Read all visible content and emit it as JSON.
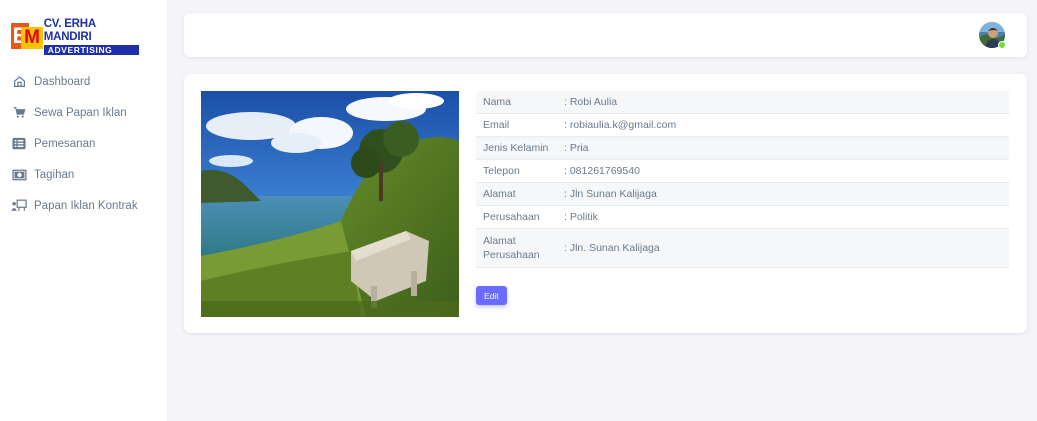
{
  "brand": {
    "logo_line1": "CV. ERHA MANDIRI",
    "logo_line2": "ADVERTISING",
    "colors": {
      "blue": "#1f2fa8",
      "orange": "#e8571a",
      "yellow": "#f5c400"
    }
  },
  "sidebar": {
    "items": [
      {
        "label": "Dashboard",
        "icon": "home-icon"
      },
      {
        "label": "Sewa Papan Iklan",
        "icon": "cart-icon"
      },
      {
        "label": "Pemesanan",
        "icon": "list-icon"
      },
      {
        "label": "Tagihan",
        "icon": "money-icon"
      },
      {
        "label": "Papan Iklan Kontrak",
        "icon": "billboard-icon"
      }
    ]
  },
  "header": {
    "avatar_icon": "user-avatar",
    "status_color": "#71dd37"
  },
  "profile": {
    "rows": [
      {
        "label": "Nama",
        "value": ": Robi Aulia"
      },
      {
        "label": "Email",
        "value": ": robiaulia.k@gmail.com"
      },
      {
        "label": "Jenis Kelamin",
        "value": ": Pria"
      },
      {
        "label": "Telepon",
        "value": ": 081261769540"
      },
      {
        "label": "Alamat",
        "value": ": Jln Sunan Kalijaga"
      },
      {
        "label": "Perusahaan",
        "value": ": Politik"
      },
      {
        "label": "Alamat Perusahaan",
        "value": ": Jln. Sunan Kalijaga"
      }
    ],
    "edit_label": "Edit"
  },
  "theme": {
    "accent": "#696cff",
    "background": "#f5f5f9"
  }
}
